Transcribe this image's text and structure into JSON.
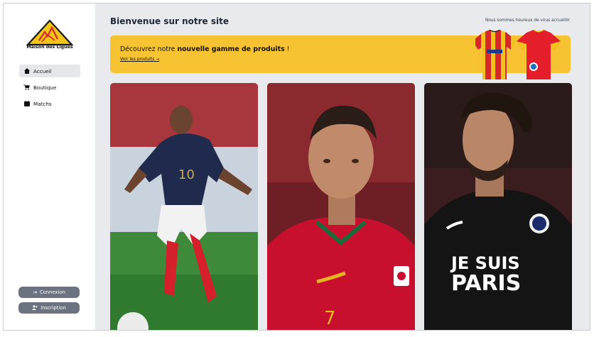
{
  "window": {
    "close_icon": "close-icon"
  },
  "sidebar": {
    "logo_text": "Maison des Ligues",
    "items": [
      {
        "label": "Accueil",
        "icon": "home-icon",
        "active": true
      },
      {
        "label": "Boutique",
        "icon": "cart-icon",
        "active": false
      },
      {
        "label": "Matchs",
        "icon": "calendar-icon",
        "active": false
      }
    ],
    "login_label": "Connexion",
    "signup_label": "Inscription"
  },
  "main": {
    "title": "Bienvenue sur notre site",
    "welcome": "Nous sommes heureux de vous accueillir",
    "banner": {
      "title_prefix": "Découvrez notre ",
      "title_bold": "nouvelle gamme de produits",
      "title_suffix": " !",
      "link": "Voir les produits →"
    },
    "photos": [
      {
        "number": "10",
        "jersey_color": "#1f2a4d"
      },
      {
        "number": "7",
        "jersey_color": "#c8102e"
      },
      {
        "line1": "JE SUIS",
        "line2": "PARIS",
        "jersey_color": "#141414"
      }
    ]
  },
  "colors": {
    "banner": "#f6c433",
    "sidebar_button": "#6b7280",
    "active_nav": "#e5e7eb"
  }
}
